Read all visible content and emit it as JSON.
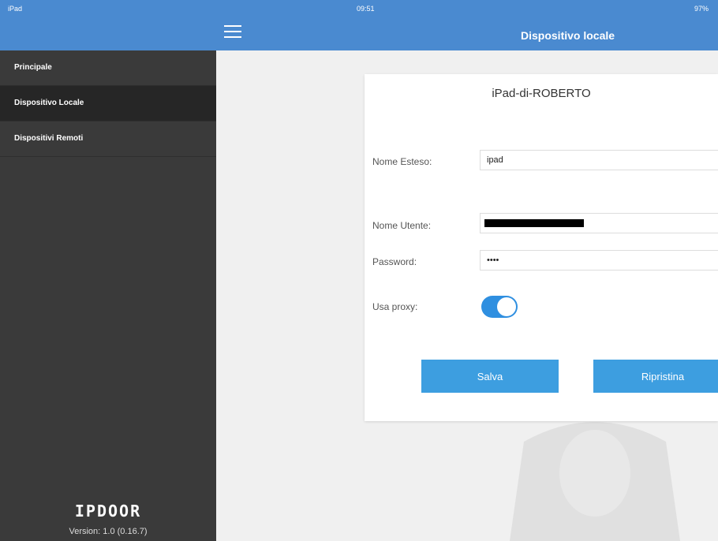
{
  "status_bar": {
    "device": "iPad",
    "time": "09:51",
    "battery": "97%"
  },
  "sidebar": {
    "items": [
      {
        "label": "Principale",
        "active": false
      },
      {
        "label": "Dispositivo Locale",
        "active": true
      },
      {
        "label": "Dispositivi Remoti",
        "active": false
      }
    ],
    "brand": "IPDOOR",
    "version": "Version: 1.0 (0.16.7)"
  },
  "header": {
    "title": "Dispositivo locale",
    "menu_icon": "hamburger-icon"
  },
  "form": {
    "device_name": "iPad-di-ROBERTO",
    "nome_esteso": {
      "label": "Nome Esteso:",
      "value": "ipad"
    },
    "nome_utente": {
      "label": "Nome Utente:",
      "value": ""
    },
    "password": {
      "label": "Password:",
      "value": "••••"
    },
    "use_proxy": {
      "label": "Usa proxy:",
      "enabled": true
    },
    "save_label": "Salva",
    "reset_label": "Ripristina"
  },
  "colors": {
    "accent": "#4a8ad0",
    "button": "#3d9ee0",
    "sidebar_bg": "#3a3a3a",
    "sidebar_active": "#262626"
  }
}
